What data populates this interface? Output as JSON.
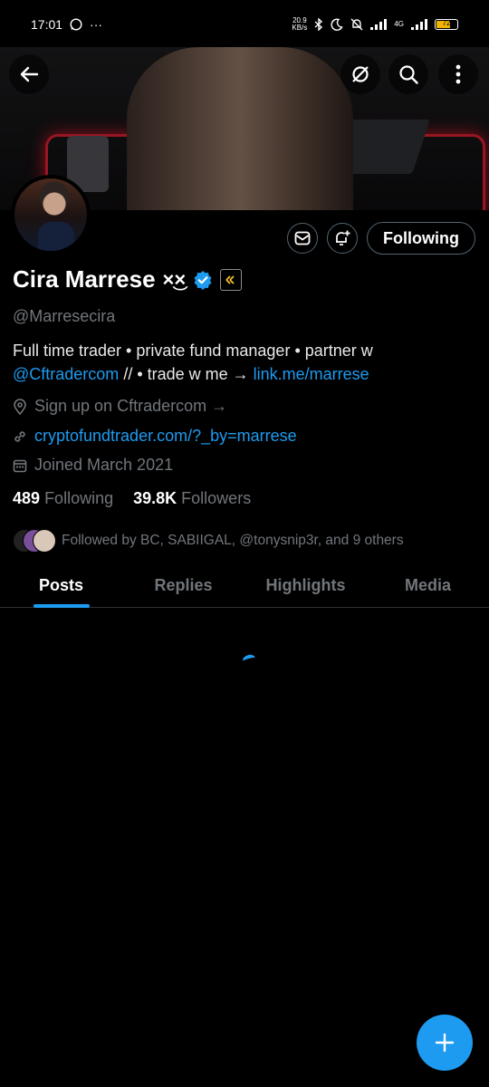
{
  "status_bar": {
    "time": "17:01",
    "more": "···",
    "net_speed_value": "20.9",
    "net_speed_unit": "KB/s",
    "network": "4G",
    "battery": "72",
    "battery_level": 0.72,
    "battery_color": "#f0b400"
  },
  "header": {
    "back_icon": "arrow-left-icon",
    "grok_icon": "grok-icon",
    "search_icon": "search-icon",
    "more_icon": "more-vertical-icon"
  },
  "profile": {
    "name": "Cira Marrese",
    "name_emoji": "×͜×",
    "handle": "@Marresecira",
    "bio_line1": "Full time trader • private fund manager • partner w",
    "bio_mention": "@Cftradercom",
    "bio_mid": " // • trade w me → ",
    "bio_link": "link.me/marrese",
    "professional_category": "Sign up on Cftradercom →",
    "website": "cryptofundtrader.com/?_by=marrese",
    "joined": "Joined March 2021",
    "following_count": "489",
    "following_label": "Following",
    "followers_count": "39.8K",
    "followers_label": "Followers",
    "followed_by": "Followed by BC, SABIIGAL, @tonysnip3r, and 9 others"
  },
  "actions": {
    "message_icon": "mail-icon",
    "notify_icon": "bell-plus-icon",
    "following_button": "Following"
  },
  "tabs": [
    {
      "label": "Posts",
      "active": true
    },
    {
      "label": "Replies",
      "active": false
    },
    {
      "label": "Highlights",
      "active": false
    },
    {
      "label": "Media",
      "active": false
    }
  ],
  "fab": {
    "icon": "plus-icon"
  },
  "colors": {
    "accent": "#1d9bf0",
    "background": "#000000",
    "muted_text": "#71767b"
  }
}
